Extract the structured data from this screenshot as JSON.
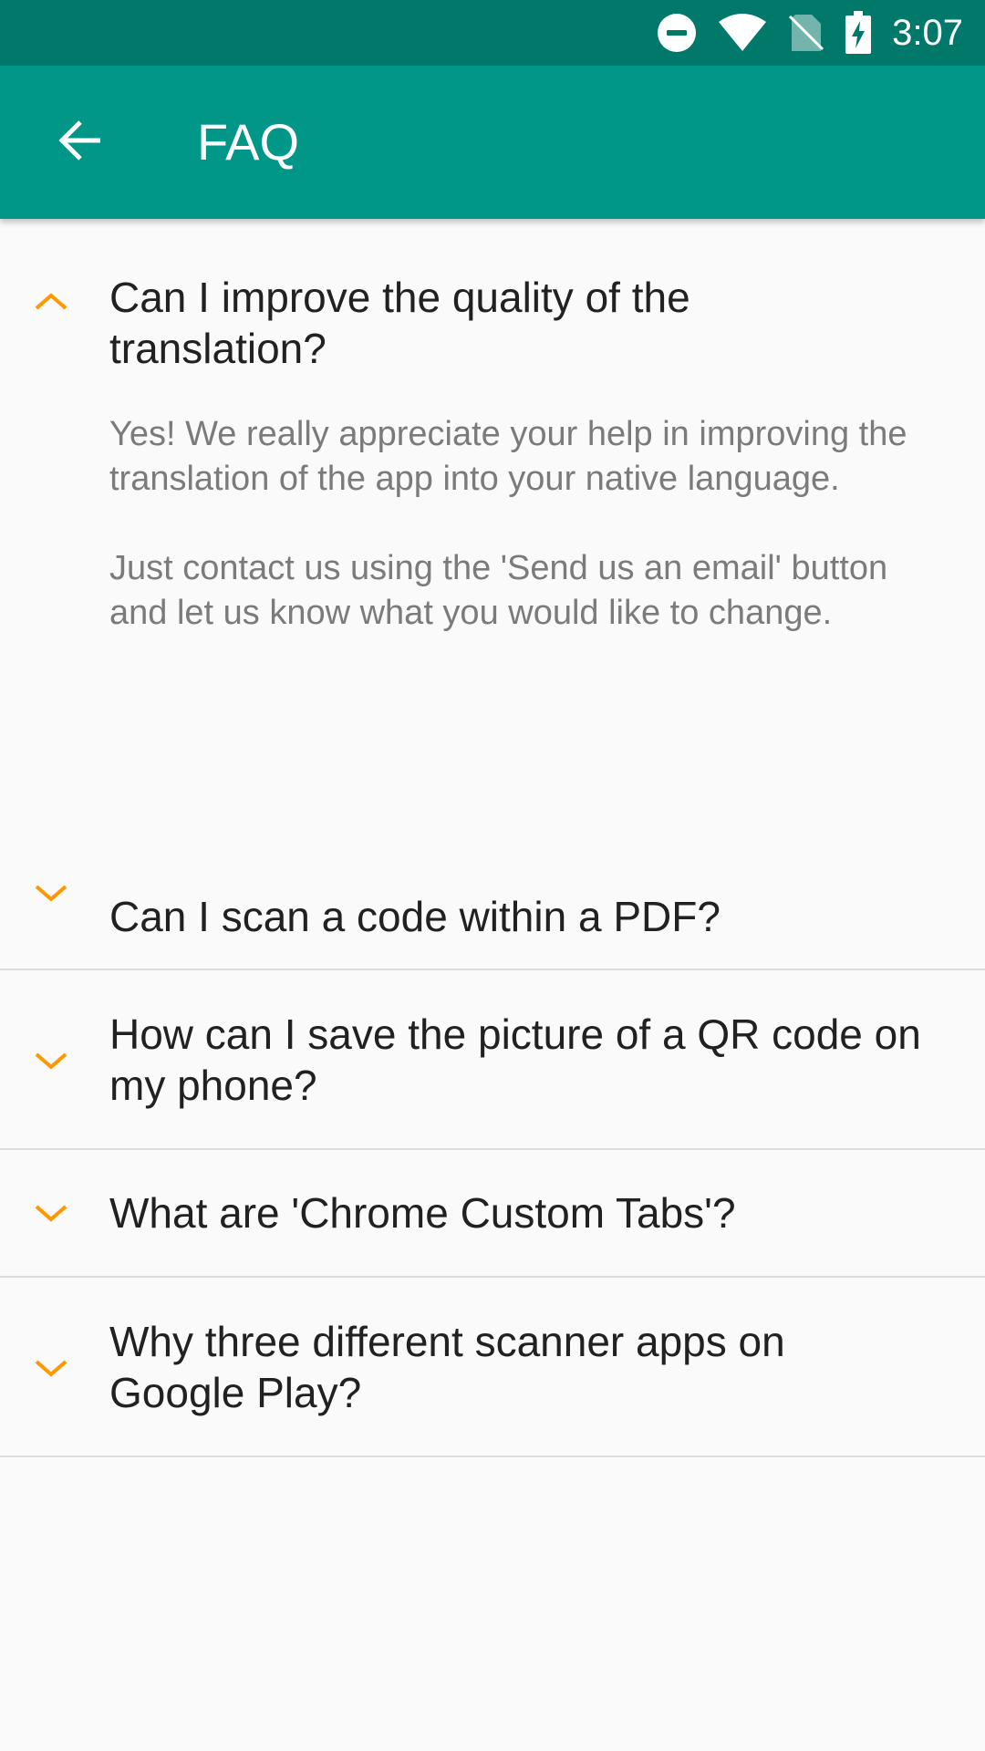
{
  "status_bar": {
    "time": "3:07",
    "icons": [
      "do-not-disturb-icon",
      "wifi-icon",
      "no-sim-icon",
      "battery-charging-icon"
    ],
    "background": "#00796b"
  },
  "app_bar": {
    "title": "FAQ",
    "back_icon": "arrow-back-icon",
    "background": "#009688"
  },
  "accent_color": "#ff9800",
  "faq": {
    "items": [
      {
        "question": "Can I improve the quality of the translation?",
        "expanded": true,
        "answer_paragraphs": [
          "Yes! We really appreciate your help in improving the translation of the app into your native language.",
          "Just contact us using the 'Send us an email' button and let us know what you would like to change."
        ]
      },
      {
        "question": "Can I scan a code within a PDF?",
        "expanded": false
      },
      {
        "question": "How can I save the picture of a QR code on my phone?",
        "expanded": false
      },
      {
        "question": "What are 'Chrome Custom Tabs'?",
        "expanded": false
      },
      {
        "question": "Why three different scanner apps on Google Play?",
        "expanded": false
      }
    ]
  }
}
